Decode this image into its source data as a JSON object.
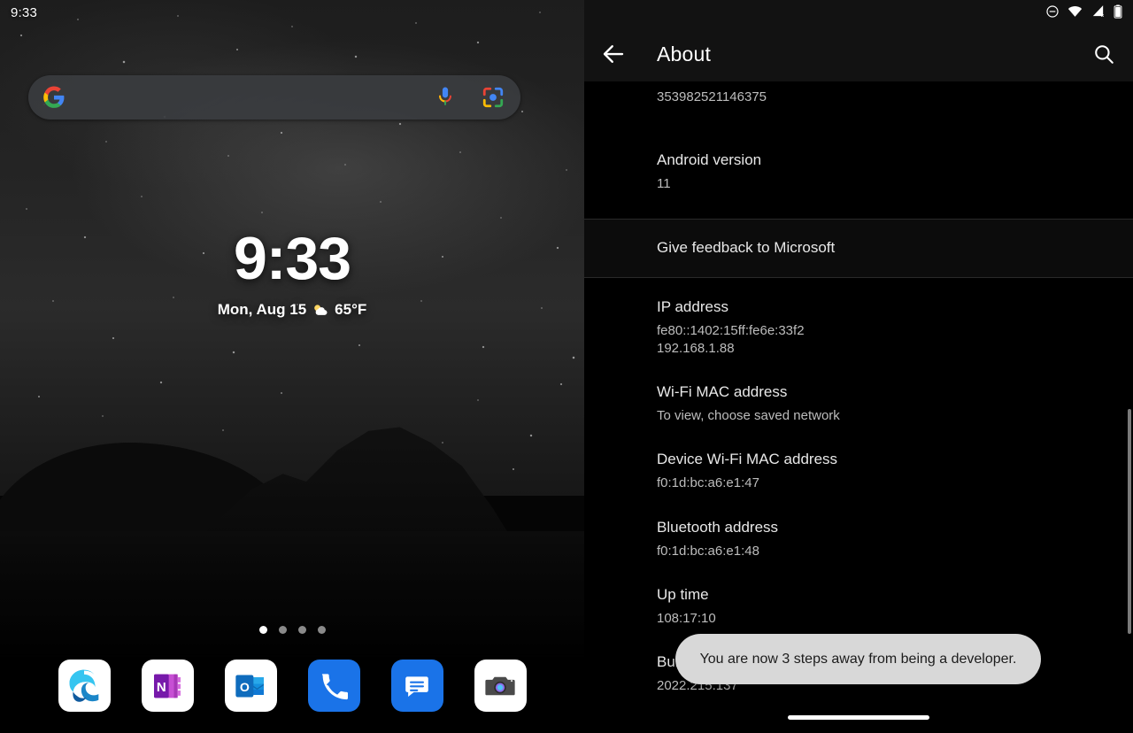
{
  "home": {
    "status_time": "9:33",
    "search": {
      "name": "google-search-bar",
      "placeholder": "",
      "value": "",
      "google_icon": "google-g-icon",
      "mic_icon": "microphone-icon",
      "lens_icon": "google-lens-icon"
    },
    "clock": {
      "time": "9:33",
      "date": "Mon, Aug 15",
      "temperature": "65°F",
      "weather_icon": "partly-cloudy-icon"
    },
    "page_dots": {
      "count": 4,
      "active_index": 0
    },
    "dock": [
      {
        "name": "microsoft-edge",
        "label": "Edge"
      },
      {
        "name": "microsoft-onenote",
        "label": "OneNote"
      },
      {
        "name": "microsoft-outlook",
        "label": "Outlook"
      },
      {
        "name": "phone",
        "label": "Phone"
      },
      {
        "name": "messages",
        "label": "Messages"
      },
      {
        "name": "camera",
        "label": "Camera"
      }
    ]
  },
  "settings": {
    "status_icons": [
      "do-not-disturb-icon",
      "wifi-icon",
      "cellular-signal-off-icon",
      "battery-icon"
    ],
    "appbar": {
      "back_icon": "back-arrow-icon",
      "title": "About",
      "search_icon": "search-icon"
    },
    "rows": [
      {
        "title": "",
        "sub": "353982521146375"
      },
      {
        "title": "Android version",
        "sub": "11"
      },
      {
        "title": "Give feedback to Microsoft",
        "sub": ""
      },
      {
        "title": "IP address",
        "sub": "fe80::1402:15ff:fe6e:33f2\n192.168.1.88"
      },
      {
        "title": "Wi-Fi MAC address",
        "sub": "To view, choose saved network"
      },
      {
        "title": "Device Wi-Fi MAC address",
        "sub": "f0:1d:bc:a6:e1:47"
      },
      {
        "title": "Bluetooth address",
        "sub": "f0:1d:bc:a6:e1:48"
      },
      {
        "title": "Up time",
        "sub": "108:17:10"
      },
      {
        "title": "Build number",
        "sub": "2022.215.137"
      }
    ],
    "toast": {
      "message": "You are now 3 steps away from being a developer."
    }
  },
  "colors": {
    "accent_blue": "#1a73e8",
    "appbar_bg": "#121212",
    "content_bg": "#000000",
    "toast_bg": "#d8d8d8",
    "divider": "#2a2a2a"
  }
}
